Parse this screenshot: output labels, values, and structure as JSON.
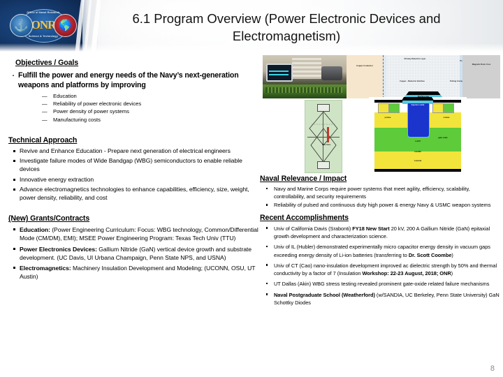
{
  "header": {
    "title": "6.1 Program Overview (Power Electronic Devices and Electromagnetism)",
    "logo": {
      "name": "ONR",
      "arc_top": "Office of Naval Research",
      "arc_bottom": "Science & Technology",
      "navy_seal_icon": "anchor-icon",
      "usmc_seal_icon": "eagle-globe-anchor-icon"
    }
  },
  "objectives": {
    "heading": "Objectives / Goals",
    "bullet": "Fulfill the power and energy needs of the Navy’s next-generation weapons and platforms by improving",
    "sub_items": [
      "Education",
      "Reliability of power electronic devices",
      "Power density of power systems",
      "Manufacturing costs"
    ]
  },
  "technical_approach": {
    "heading": "Technical Approach",
    "items": [
      "Revive and Enhance Education - Prepare next generation of electrical engineers",
      "Investigate failure modes of Wide Bandgap (WBG) semiconductors to enable reliable devices",
      "Innovative energy extraction",
      "Advance electromagnetics technologies to enhance capabilities, efficiency, size, weight, power density, reliability, and cost"
    ]
  },
  "grants": {
    "heading": "(New) Grants/Contracts",
    "items": [
      {
        "lead": "Education:",
        "text": " (Power Engineering Curriculum: Focus: WBG technology, Common/Differential Mode (CM/DM), EMI); MSEE Power Engineering Program: Texas Tech Univ (TTU)"
      },
      {
        "lead": "Power Electronics Devices:",
        "text": " Gallium Nitride (GaN) vertical device growth and substrate development. (UC Davis, UI Urbana Champaign, Penn State NPS, and USNA)"
      },
      {
        "lead": "Electromagnetics:",
        "text": " Machinery Insulation Development and Modeling; (UCONN, OSU, UT Austin)"
      }
    ]
  },
  "naval_relevance": {
    "heading": "Naval Relevance / Impact",
    "items": [
      "Navy and Marine Corps require power systems that meet agility, efficiency, scalability, controllability, and security requirements",
      "Reliability of pulsed and continuous duty high power & energy Navy & USMC weapon systems"
    ]
  },
  "accomplishments": {
    "heading": "Recent Accomplishments",
    "items": [
      {
        "pre": "Univ of California Davis (Srabonti) ",
        "bold": "FY18 New Start",
        "post": " 20 kV, 200 A Gallium Nitride (GaN) epitaxial growth development and characterization science."
      },
      {
        "pre": "Univ of IL (Hubler) demonstrated experimentally micro capacitor energy density in vacuum gaps exceeding energy density of Li-ion batteries (transferring to ",
        "bold": "Dr. Scott Coombe",
        "post": ")"
      },
      {
        "pre": "Univ of CT (Cao) nano-insulation development improved ac dielectric strength by 50% and thermal conductivity by a factor of 7 (Insulation ",
        "bold": "Workshop: 22-23 August, 2018; ONR",
        "post": ")"
      },
      {
        "pre": "UT Dallas (Akin) WBG stress testing revealed prominent gate-oxide related failure mechanisms",
        "bold": "",
        "post": ""
      },
      {
        "pre": "",
        "bold": "Naval Postgraduate School (Weatherford)",
        "post": " (w/SANDIA, UC Berkeley, Penn State University) GaN Schottky Diodes"
      }
    ]
  },
  "figures": {
    "lab_photo": {
      "name": "power-electronics-lab-photo",
      "elements": [
        "oscilloscope",
        "instrument-rack",
        "motor",
        "green-pcb"
      ]
    },
    "insulation_diagram": {
      "name": "machinery-insulation-cross-section",
      "labels": [
        "Copper Conductor",
        "Primary Dielectric Layer",
        "Copper - Dielectric Interface",
        "Potting Compound",
        "Possible Void Lines",
        "Magnetic Rotor Core",
        "Machine Gap"
      ]
    },
    "lattice_diagram": {
      "name": "energy-extraction-lattice-diagram",
      "label": "Wire lines"
    },
    "semiconductor_diagram": {
      "name": "gan-vertical-device-cross-section",
      "labels": [
        "Injection oxide",
        "gate oxide",
        "p-base",
        "n-base",
        "n-drift",
        "n-buffer",
        "n-anode",
        "p+",
        "n+"
      ]
    }
  },
  "page_number": "8"
}
